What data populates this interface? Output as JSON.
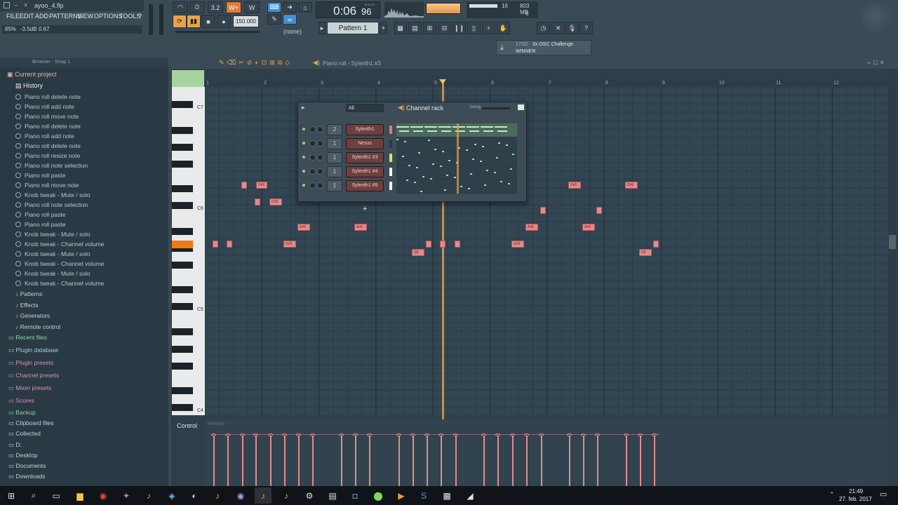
{
  "title": {
    "filename": "ayoo_4.flp"
  },
  "menu": [
    "FILE",
    "EDIT",
    "ADD",
    "PATTERNS",
    "VIEW",
    "OPTIONS",
    "TOOLS",
    "?"
  ],
  "hint": {
    "zoom": "85%",
    "vol": "-3.5dB",
    "val": "0.67"
  },
  "transport": {
    "time_main": "0:06",
    "time_sub": "96",
    "time_unit": "M:S:CS",
    "tempo": "150.000",
    "pattern": "Pattern 1",
    "none": "(none)"
  },
  "monitor": {
    "cpu": "16",
    "mem": "803 MB",
    "poly": "6"
  },
  "news": {
    "date": "17/02",
    "text": "3x OSC Challenge",
    "status": "WINNER"
  },
  "browser": {
    "title": "Browser - Snap 1",
    "current_project": "Current project",
    "history_label": "History",
    "history": [
      "Piano roll delete note",
      "Piano roll add note",
      "Piano roll move note",
      "Piano roll delete note",
      "Piano roll add note",
      "Piano roll delete note",
      "Piano roll resize note",
      "Piano roll note selection",
      "Piano roll paste",
      "Piano roll move note",
      "Knob tweak - Mute / solo",
      "Piano roll note selection",
      "Piano roll paste",
      "Piano roll paste",
      "Knob tweak - Mute / solo",
      "Knob tweak - Channel volume",
      "Knob tweak - Mute / solo",
      "Knob tweak - Channel volume",
      "Knob tweak - Mute / solo",
      "Knob tweak - Channel volume"
    ],
    "project_items": [
      "Patterns",
      "Effects",
      "Generators",
      "Remote control"
    ],
    "folders": [
      "Recent files",
      "Plugin database",
      "Plugin presets",
      "Channel presets",
      "Mixer presets",
      "Scores",
      "Backup",
      "Clipboard files",
      "Collected",
      "D:",
      "Desktop",
      "Documents",
      "Downloads"
    ]
  },
  "pianoroll": {
    "title": "Piano roll - Sylenth1 #3",
    "bars": [
      "1",
      "2",
      "3",
      "4",
      "5",
      "6",
      "7",
      "8",
      "9",
      "10",
      "11",
      "12"
    ],
    "octaves": [
      "C7",
      "C6",
      "C5",
      "C4"
    ],
    "control": "Control",
    "velocity": "Velocity"
  },
  "notes_labels": {
    "ds6": "D#6",
    "cs6": "C#6",
    "as5": "A#5",
    "gs5": "G#5",
    "g5": "G5"
  },
  "channel_rack": {
    "title": "Channel rack",
    "filter": "All",
    "swing": "Swing",
    "channels": [
      {
        "num": "2",
        "name": "Sylenth1"
      },
      {
        "num": "1",
        "name": "Nexus"
      },
      {
        "num": "1",
        "name": "Sylenth1 #3"
      },
      {
        "num": "1",
        "name": "Sylenth1 #4"
      },
      {
        "num": "1",
        "name": "Sylenth1 #5"
      }
    ],
    "add": "+"
  },
  "clock": {
    "time": "21:49",
    "date": "27. feb. 2017"
  }
}
